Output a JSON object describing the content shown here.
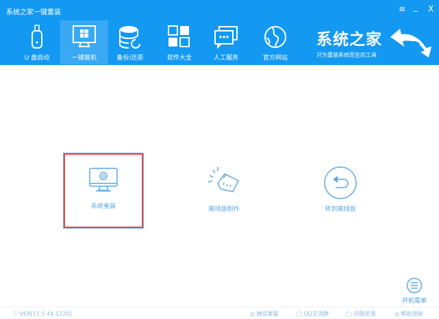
{
  "window": {
    "title": "系统之家一键重装",
    "menu_icon": "≡",
    "minimize": "_",
    "close": "X"
  },
  "nav": [
    {
      "label": "U 盘启动",
      "icon": "usb-icon"
    },
    {
      "label": "一键装机",
      "icon": "monitor-windows-icon",
      "active": true
    },
    {
      "label": "备份/还原",
      "icon": "database-icon"
    },
    {
      "label": "软件大全",
      "icon": "apps-grid-icon"
    },
    {
      "label": "人工服务",
      "icon": "chat-icon"
    },
    {
      "label": "官方网站",
      "icon": "globe-icon"
    }
  ],
  "brand": {
    "name": "系统之家",
    "slogan": "只为重装系统而生的工具"
  },
  "cards": [
    {
      "label": "系统重装",
      "icon": "monitor-gear-icon",
      "selected": true
    },
    {
      "label": "离线版制作",
      "icon": "network-plug-icon"
    },
    {
      "label": "转到离线版",
      "icon": "back-arrow-icon"
    }
  ],
  "boot_menu": {
    "label": "开机菜单"
  },
  "footer": {
    "version": "VER[11.5.44.1220]",
    "links": [
      "微信客服",
      "QQ交流群",
      "问题反馈",
      "帮助视频"
    ]
  },
  "colors": {
    "header": "#1399f2",
    "accent": "#5aa8e6",
    "selection": "#e04a4a"
  }
}
